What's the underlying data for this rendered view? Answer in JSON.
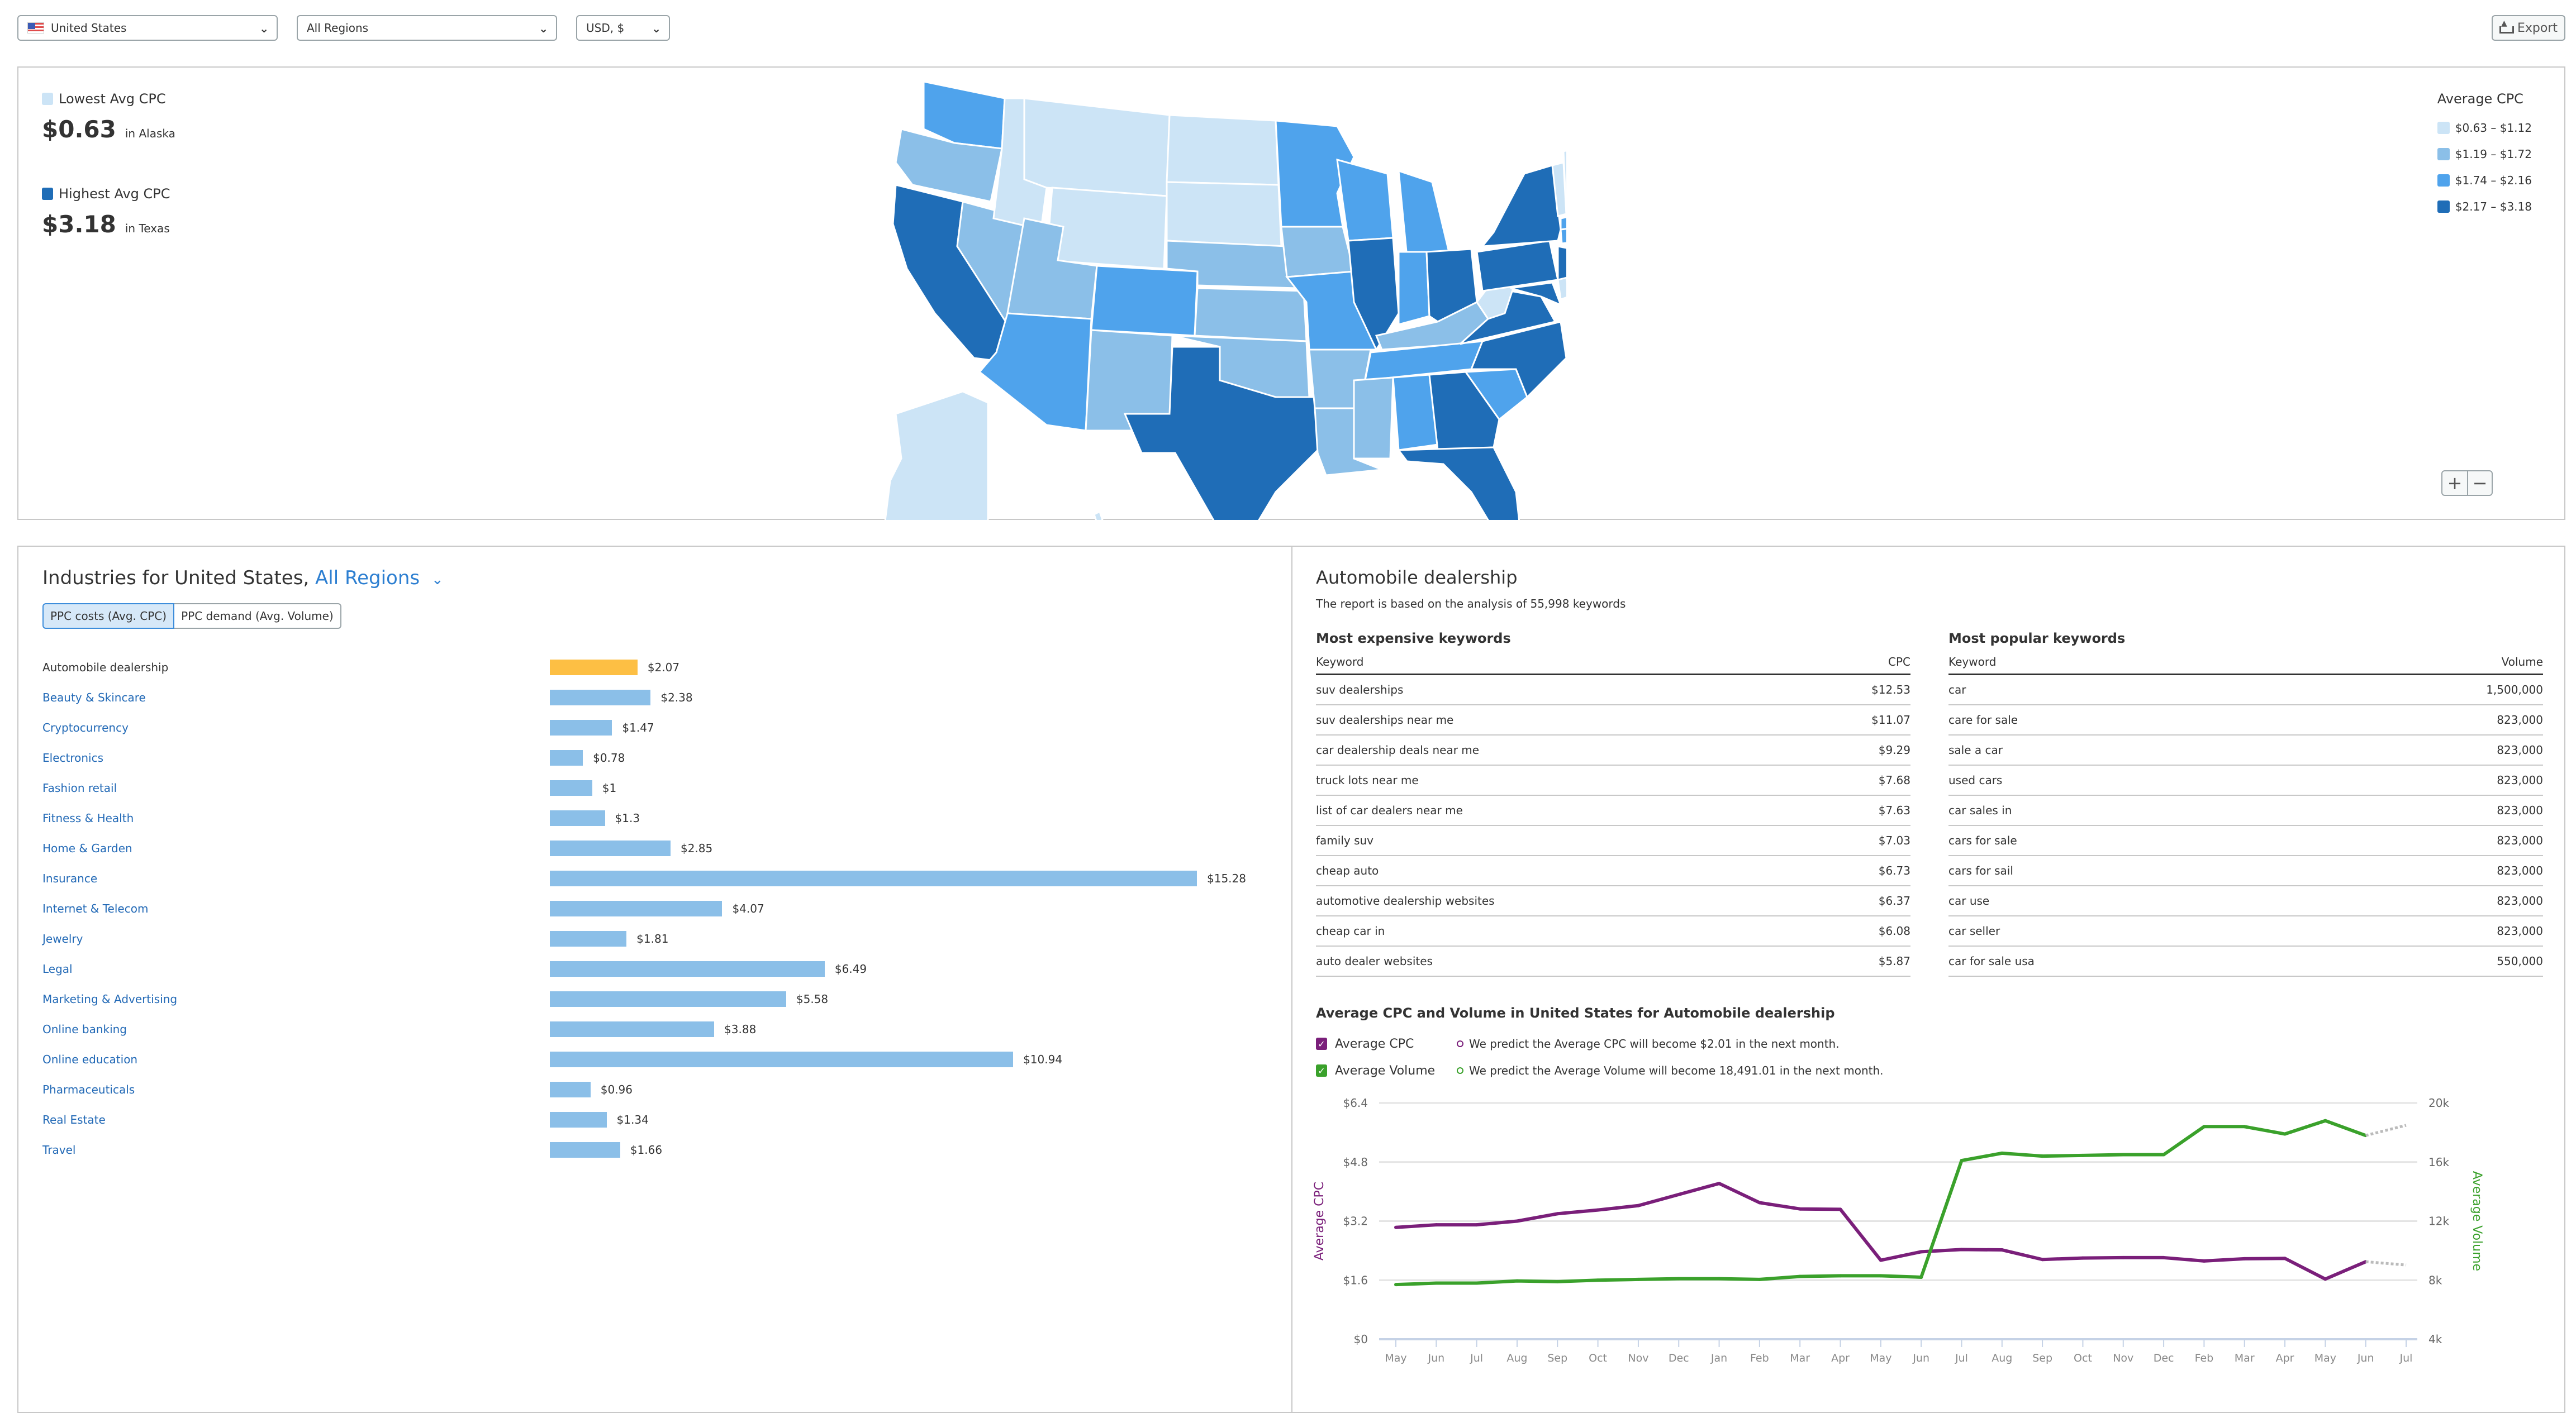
{
  "toolbar": {
    "country": "United States",
    "region": "All Regions",
    "currency": "USD, $",
    "export_label": "Export",
    "icons": {
      "country_flag": "us-flag-icon",
      "dropdown": "chevron-down-icon",
      "export": "export-icon"
    }
  },
  "map_panel": {
    "lowest": {
      "label": "Lowest Avg CPC",
      "value": "$0.63",
      "location": "in Alaska",
      "color": "#cce4f6"
    },
    "highest": {
      "label": "Highest Avg CPC",
      "value": "$3.18",
      "location": "in Texas",
      "color": "#1f6db7"
    },
    "legend": {
      "title": "Average CPC",
      "items": [
        {
          "label": "$0.63 – $1.12",
          "color": "#cce4f6"
        },
        {
          "label": "$1.19 – $1.72",
          "color": "#8bbfe8"
        },
        {
          "label": "$1.74 – $2.16",
          "color": "#4fa3ec"
        },
        {
          "label": "$2.17 – $3.18",
          "color": "#1f6db7"
        }
      ]
    },
    "zoom_in": "+",
    "zoom_out": "−",
    "states": [
      {
        "name": "Alaska",
        "tier": 0
      },
      {
        "name": "Washington",
        "tier": 2
      },
      {
        "name": "Oregon",
        "tier": 1
      },
      {
        "name": "California",
        "tier": 3
      },
      {
        "name": "Nevada",
        "tier": 1
      },
      {
        "name": "Idaho",
        "tier": 0
      },
      {
        "name": "Montana",
        "tier": 0
      },
      {
        "name": "Wyoming",
        "tier": 0
      },
      {
        "name": "Utah",
        "tier": 1
      },
      {
        "name": "Arizona",
        "tier": 2
      },
      {
        "name": "Colorado",
        "tier": 2
      },
      {
        "name": "New Mexico",
        "tier": 1
      },
      {
        "name": "North Dakota",
        "tier": 0
      },
      {
        "name": "South Dakota",
        "tier": 0
      },
      {
        "name": "Nebraska",
        "tier": 1
      },
      {
        "name": "Kansas",
        "tier": 1
      },
      {
        "name": "Oklahoma",
        "tier": 1
      },
      {
        "name": "Texas",
        "tier": 3
      },
      {
        "name": "Minnesota",
        "tier": 2
      },
      {
        "name": "Iowa",
        "tier": 1
      },
      {
        "name": "Missouri",
        "tier": 2
      },
      {
        "name": "Arkansas",
        "tier": 1
      },
      {
        "name": "Louisiana",
        "tier": 1
      },
      {
        "name": "Wisconsin",
        "tier": 2
      },
      {
        "name": "Illinois",
        "tier": 3
      },
      {
        "name": "Michigan",
        "tier": 2
      },
      {
        "name": "Indiana",
        "tier": 2
      },
      {
        "name": "Ohio",
        "tier": 3
      },
      {
        "name": "Kentucky",
        "tier": 1
      },
      {
        "name": "Tennessee",
        "tier": 2
      },
      {
        "name": "Mississippi",
        "tier": 1
      },
      {
        "name": "Alabama",
        "tier": 2
      },
      {
        "name": "Georgia",
        "tier": 3
      },
      {
        "name": "Florida",
        "tier": 3
      },
      {
        "name": "South Carolina",
        "tier": 2
      },
      {
        "name": "North Carolina",
        "tier": 3
      },
      {
        "name": "Virginia",
        "tier": 3
      },
      {
        "name": "West Virginia",
        "tier": 0
      },
      {
        "name": "Pennsylvania",
        "tier": 3
      },
      {
        "name": "New York",
        "tier": 3
      },
      {
        "name": "Maryland",
        "tier": 3
      },
      {
        "name": "Delaware",
        "tier": 0
      },
      {
        "name": "New Jersey",
        "tier": 3
      },
      {
        "name": "Connecticut",
        "tier": 2
      },
      {
        "name": "Massachusetts",
        "tier": 2
      },
      {
        "name": "Vermont",
        "tier": 0
      },
      {
        "name": "New Hampshire",
        "tier": 0
      },
      {
        "name": "Maine",
        "tier": 0
      },
      {
        "name": "Hawaii",
        "tier": 0
      }
    ]
  },
  "industries": {
    "title_prefix": "Industries for United States,",
    "region_link": "All Regions",
    "tabs": [
      {
        "label": "PPC costs (Avg. CPC)",
        "active": true
      },
      {
        "label": "PPC demand (Avg. Volume)",
        "active": false
      }
    ],
    "bar_colors": {
      "selected": "#fdbf44",
      "default": "#8bbfe8"
    },
    "items": [
      {
        "name": "Automobile dealership",
        "value": 2.07,
        "label": "$2.07",
        "selected": true
      },
      {
        "name": "Beauty & Skincare",
        "value": 2.38,
        "label": "$2.38"
      },
      {
        "name": "Cryptocurrency",
        "value": 1.47,
        "label": "$1.47"
      },
      {
        "name": "Electronics",
        "value": 0.78,
        "label": "$0.78"
      },
      {
        "name": "Fashion retail",
        "value": 1.0,
        "label": "$1"
      },
      {
        "name": "Fitness & Health",
        "value": 1.3,
        "label": "$1.3"
      },
      {
        "name": "Home & Garden",
        "value": 2.85,
        "label": "$2.85"
      },
      {
        "name": "Insurance",
        "value": 15.28,
        "label": "$15.28"
      },
      {
        "name": "Internet & Telecom",
        "value": 4.07,
        "label": "$4.07"
      },
      {
        "name": "Jewelry",
        "value": 1.81,
        "label": "$1.81"
      },
      {
        "name": "Legal",
        "value": 6.49,
        "label": "$6.49"
      },
      {
        "name": "Marketing & Advertising",
        "value": 5.58,
        "label": "$5.58"
      },
      {
        "name": "Online banking",
        "value": 3.88,
        "label": "$3.88"
      },
      {
        "name": "Online education",
        "value": 10.94,
        "label": "$10.94"
      },
      {
        "name": "Pharmaceuticals",
        "value": 0.96,
        "label": "$0.96"
      },
      {
        "name": "Real Estate",
        "value": 1.34,
        "label": "$1.34"
      },
      {
        "name": "Travel",
        "value": 1.66,
        "label": "$1.66"
      }
    ]
  },
  "details": {
    "title": "Automobile dealership",
    "subtitle": "The report is based on the analysis of 55,998 keywords",
    "expensive": {
      "title": "Most expensive keywords",
      "col_keyword": "Keyword",
      "col_value": "CPC",
      "rows": [
        {
          "keyword": "suv dealerships",
          "value": "$12.53"
        },
        {
          "keyword": "suv dealerships near me",
          "value": "$11.07"
        },
        {
          "keyword": "car dealership deals near me",
          "value": "$9.29"
        },
        {
          "keyword": "truck lots near me",
          "value": "$7.68"
        },
        {
          "keyword": "list of car dealers near me",
          "value": "$7.63"
        },
        {
          "keyword": "family suv",
          "value": "$7.03"
        },
        {
          "keyword": "cheap auto",
          "value": "$6.73"
        },
        {
          "keyword": "automotive dealership websites",
          "value": "$6.37"
        },
        {
          "keyword": "cheap car in",
          "value": "$6.08"
        },
        {
          "keyword": "auto dealer websites",
          "value": "$5.87"
        }
      ]
    },
    "popular": {
      "title": "Most popular keywords",
      "col_keyword": "Keyword",
      "col_value": "Volume",
      "rows": [
        {
          "keyword": "car",
          "value": "1,500,000"
        },
        {
          "keyword": "care for sale",
          "value": "823,000"
        },
        {
          "keyword": "sale a car",
          "value": "823,000"
        },
        {
          "keyword": "used cars",
          "value": "823,000"
        },
        {
          "keyword": "car sales in",
          "value": "823,000"
        },
        {
          "keyword": "cars for sale",
          "value": "823,000"
        },
        {
          "keyword": "cars for sail",
          "value": "823,000"
        },
        {
          "keyword": "car use",
          "value": "823,000"
        },
        {
          "keyword": "car seller",
          "value": "823,000"
        },
        {
          "keyword": "car for sale usa",
          "value": "550,000"
        }
      ]
    },
    "trend": {
      "title": "Average CPC and Volume in United States for Automobile dealership",
      "series_toggles": [
        {
          "label": "Average CPC",
          "checked": true,
          "color": "#7a1f7a",
          "prediction": "We predict the Average CPC will become $2.01 in the next month."
        },
        {
          "label": "Average Volume",
          "checked": true,
          "color": "#3aa12b",
          "prediction": "We predict the Average Volume will become 18,491.01 in the next month."
        }
      ]
    }
  },
  "chart_data": [
    {
      "type": "bar",
      "title": "Industries for United States, All Regions — PPC costs (Avg. CPC)",
      "orientation": "horizontal",
      "categories": [
        "Automobile dealership",
        "Beauty & Skincare",
        "Cryptocurrency",
        "Electronics",
        "Fashion retail",
        "Fitness & Health",
        "Home & Garden",
        "Insurance",
        "Internet & Telecom",
        "Jewelry",
        "Legal",
        "Marketing & Advertising",
        "Online banking",
        "Online education",
        "Pharmaceuticals",
        "Real Estate",
        "Travel"
      ],
      "values": [
        2.07,
        2.38,
        1.47,
        0.78,
        1.0,
        1.3,
        2.85,
        15.28,
        4.07,
        1.81,
        6.49,
        5.58,
        3.88,
        10.94,
        0.96,
        1.34,
        1.66
      ],
      "highlighted": "Automobile dealership",
      "xlabel": "",
      "ylabel": ""
    },
    {
      "type": "line",
      "title": "Average CPC and Volume in United States for Automobile dealership",
      "x": [
        "May",
        "Jun",
        "Jul",
        "Aug",
        "Sep",
        "Oct",
        "Nov",
        "Dec",
        "Jan",
        "Feb",
        "Mar",
        "Apr",
        "May",
        "Jun",
        "Jul",
        "Aug",
        "Sep",
        "Oct",
        "Nov",
        "Dec",
        "Feb",
        "Mar",
        "Apr",
        "May",
        "Jun",
        "Jul"
      ],
      "series": [
        {
          "name": "Average CPC",
          "axis": "left",
          "color": "#7a1f7a",
          "values": [
            3.03,
            3.1,
            3.1,
            3.2,
            3.4,
            3.5,
            3.62,
            3.92,
            4.22,
            3.7,
            3.53,
            3.52,
            2.14,
            2.37,
            2.43,
            2.42,
            2.16,
            2.2,
            2.21,
            2.21,
            2.12,
            2.18,
            2.19,
            1.63,
            2.1,
            null
          ],
          "prediction": {
            "x": "Jul",
            "value": 2.01
          }
        },
        {
          "name": "Average Volume",
          "axis": "right",
          "color": "#3aa12b",
          "values": [
            7700,
            7800,
            7800,
            7950,
            7900,
            8000,
            8050,
            8100,
            8100,
            8050,
            8250,
            8300,
            8300,
            8200,
            16100,
            16600,
            16400,
            16450,
            16500,
            16500,
            18400,
            18400,
            17900,
            18800,
            17800,
            null
          ],
          "prediction": {
            "x": "Jul",
            "value": 18491.01
          }
        }
      ],
      "ylabel": "Average CPC",
      "y2label": "Average Volume",
      "ylim": [
        0,
        6.4
      ],
      "y2lim": [
        4000,
        20000
      ],
      "yticks": [
        "$0",
        "$1.6",
        "$3.2",
        "$4.8",
        "$6.4"
      ],
      "y2ticks": [
        "4k",
        "8k",
        "12k",
        "16k",
        "20k"
      ],
      "grid": true
    }
  ]
}
